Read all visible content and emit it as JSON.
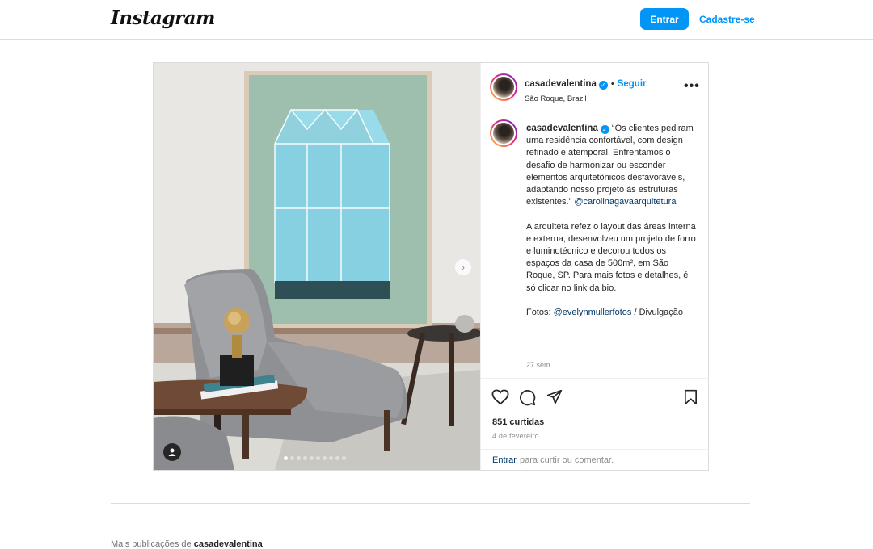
{
  "header": {
    "logo": "Instagram",
    "login_label": "Entrar",
    "signup_label": "Cadastre-se"
  },
  "post": {
    "username": "casadevalentina",
    "follow_label": "Seguir",
    "separator": "•",
    "location": "São Roque, Brazil",
    "more_label": "•••",
    "caption": {
      "username": "casadevalentina",
      "text_1": "“Os clientes pediram uma residência confortável, com design refinado e atemporal. Enfrentamos o desafio de harmonizar ou esconder elementos arquitetônicos desfavoráveis, adaptando nosso projeto às estruturas existentes.”",
      "mention_1": "@carolinagavaarquitetura",
      "text_2": "A arquiteta refez o layout das áreas interna e externa, desenvolveu um projeto de forro e luminotécnico e decorou todos os espaços da casa de 500m², em São Roque, SP. Para mais fotos e detalhes, é só clicar no link da bio.",
      "photos_label": "Fotos:",
      "mention_2": "@evelynmullerfotos",
      "photos_suffix": "/ Divulgação",
      "time_ago": "27 sem"
    },
    "likes": "851 curtidas",
    "date": "4 de fevereiro",
    "comment_login": "Entrar",
    "comment_rest": "para curtir ou comentar.",
    "carousel": {
      "count": 10,
      "active_index": 0
    },
    "icons": [
      "heart-icon",
      "comment-icon",
      "share-icon",
      "bookmark-icon",
      "next-arrow-icon",
      "user-tag-icon"
    ]
  },
  "footer": {
    "more_posts_prefix": "Mais publicações de",
    "more_posts_user": "casadevalentina"
  },
  "colors": {
    "accent": "#0095f6",
    "border": "#dbdbdb",
    "muted": "#8e8e8e",
    "mention": "#00376b"
  }
}
